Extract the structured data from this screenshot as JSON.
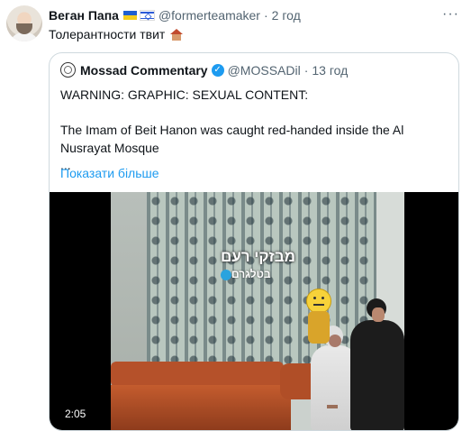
{
  "tweet": {
    "author_name": "Веган Папа",
    "author_handle": "@formerteamaker",
    "separator": "·",
    "time": "2 год",
    "text": "Толерантности твит",
    "more_label": "···"
  },
  "quoted_tweet": {
    "author_name": "Mossad Commentary",
    "verified_mark": "✓",
    "author_handle": "@MOSSADil",
    "separator": "·",
    "time": "13 год",
    "lines": [
      "WARNING: GRAPHIC: SEXUAL CONTENT:",
      "The Imam of Beit Hanon was caught red-handed inside the Al Nusrayat Mosque",
      "..."
    ],
    "show_more": "Показати більше"
  },
  "media": {
    "duration": "2:05",
    "watermark_main": "מבזקי רעם",
    "watermark_sub": "בטלגרם"
  },
  "colors": {
    "link": "#1d9bf0",
    "muted": "#536471",
    "border": "#cfd9de"
  }
}
